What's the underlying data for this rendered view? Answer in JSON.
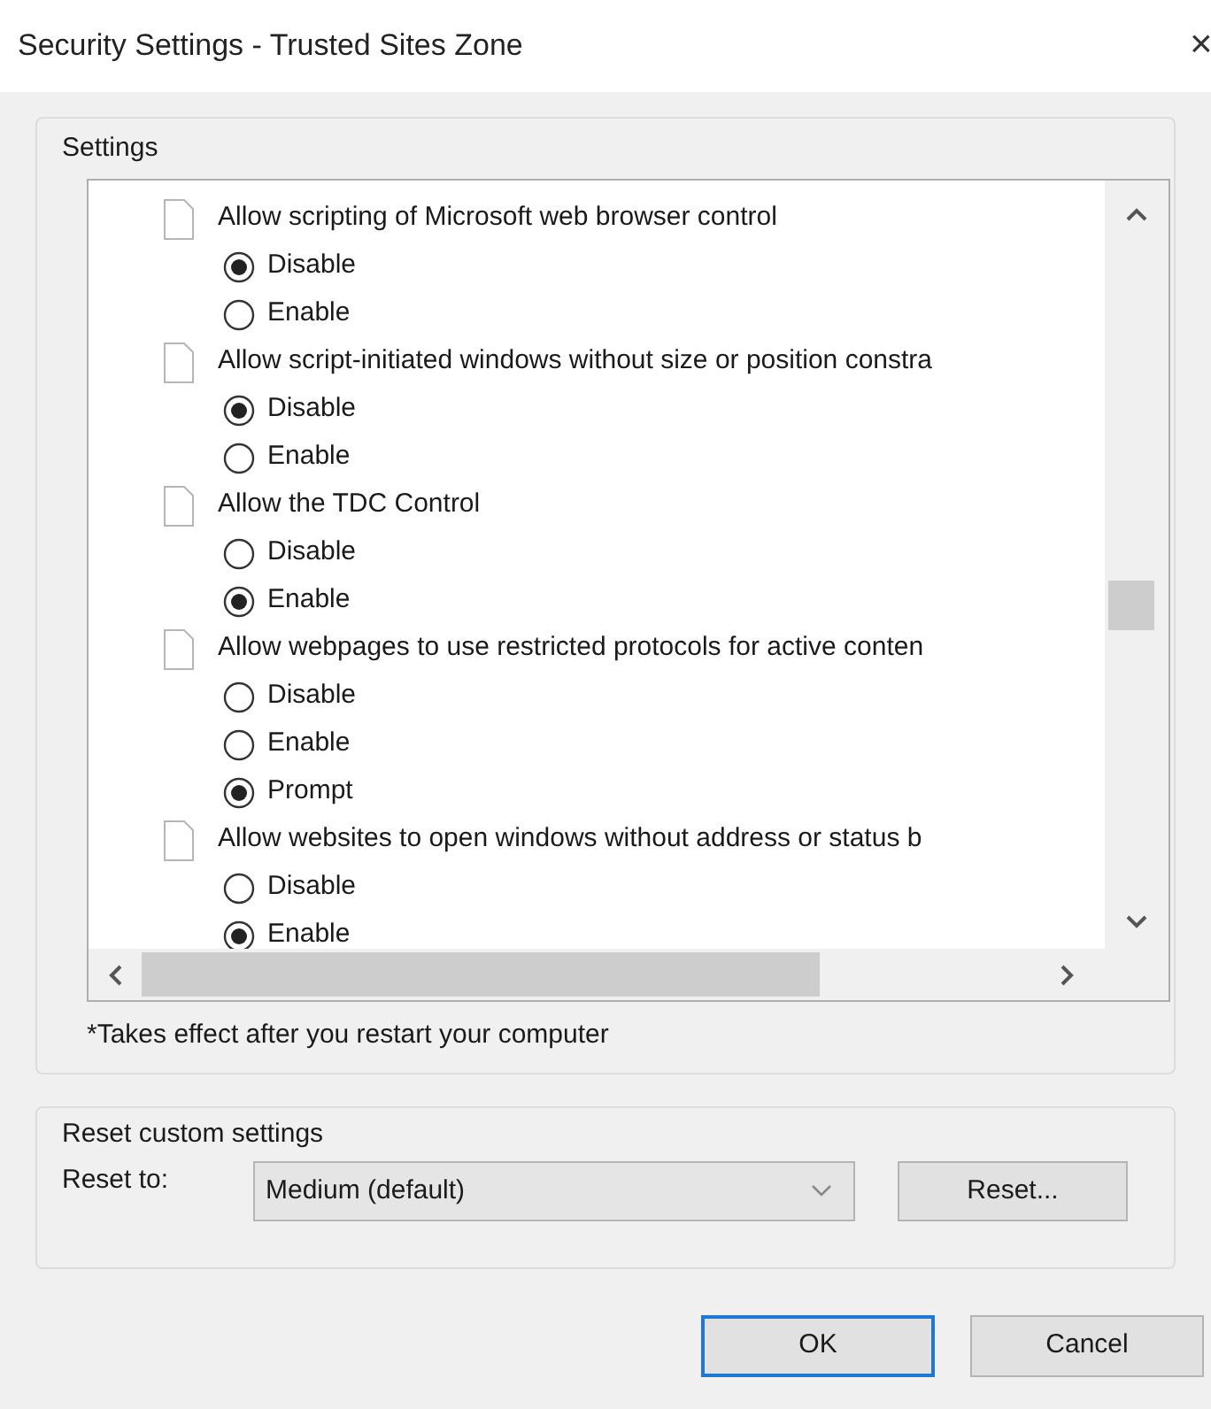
{
  "window": {
    "title": "Security Settings - Trusted Sites Zone",
    "close": "×"
  },
  "settings": {
    "label": "Settings",
    "items": [
      {
        "label": "Allow scripting of Microsoft web browser control",
        "options": [
          {
            "label": "Disable",
            "selected": true
          },
          {
            "label": "Enable",
            "selected": false
          }
        ]
      },
      {
        "label": "Allow script-initiated windows without size or position constra",
        "options": [
          {
            "label": "Disable",
            "selected": true
          },
          {
            "label": "Enable",
            "selected": false
          }
        ]
      },
      {
        "label": "Allow the TDC Control",
        "options": [
          {
            "label": "Disable",
            "selected": false
          },
          {
            "label": "Enable",
            "selected": true
          }
        ]
      },
      {
        "label": "Allow webpages to use restricted protocols for active conten",
        "options": [
          {
            "label": "Disable",
            "selected": false
          },
          {
            "label": "Enable",
            "selected": false
          },
          {
            "label": "Prompt",
            "selected": true
          }
        ]
      },
      {
        "label": "Allow websites to open windows without address or status b",
        "options": [
          {
            "label": "Disable",
            "selected": false
          },
          {
            "label": "Enable",
            "selected": true
          }
        ]
      }
    ],
    "note": "*Takes effect after you restart your computer"
  },
  "reset": {
    "label": "Reset custom settings",
    "reset_to_label": "Reset to:",
    "dropdown_value": "Medium (default)",
    "reset_button": "Reset..."
  },
  "buttons": [
    {
      "label": "OK",
      "focused": true
    },
    {
      "label": "Cancel",
      "focused": false
    }
  ]
}
